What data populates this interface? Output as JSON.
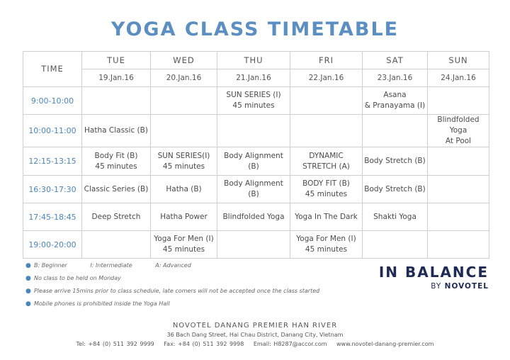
{
  "title": "YOGA CLASS TIMETABLE",
  "table": {
    "time_header": "TIME",
    "days": [
      "TUE",
      "WED",
      "THU",
      "FRI",
      "SAT",
      "SUN"
    ],
    "dates": [
      "19.Jan.16",
      "20.Jan.16",
      "21.Jan.16",
      "22.Jan.16",
      "23.Jan.16",
      "24.Jan.16"
    ],
    "rows": [
      {
        "time": "9:00-10:00",
        "cells": [
          [],
          [],
          [
            "SUN SERIES (I)",
            "45 minutes"
          ],
          [],
          [
            "Asana",
            "& Pranayama (I)"
          ],
          []
        ]
      },
      {
        "time": "10:00-11:00",
        "cells": [
          [
            "Hatha Classic (B)"
          ],
          [],
          [],
          [],
          [],
          [
            "Blindfolded Yoga",
            "At Pool"
          ]
        ]
      },
      {
        "time": "12:15-13:15",
        "cells": [
          [
            "Body Fit (B)",
            "45 minutes"
          ],
          [
            "SUN SERIES(I)",
            "45 minutes"
          ],
          [
            "Body Alignment (B)"
          ],
          [
            "DYNAMIC",
            "STRETCH (A)"
          ],
          [
            "Body Stretch (B)"
          ],
          []
        ]
      },
      {
        "time": "16:30-17:30",
        "cells": [
          [
            "Classic Series (B)"
          ],
          [
            "Hatha (B)"
          ],
          [
            "Body Alignment (B)"
          ],
          [
            "BODY FIT (B)",
            "45 minutes"
          ],
          [
            "Body Stretch (B)"
          ],
          []
        ]
      },
      {
        "time": "17:45-18:45",
        "cells": [
          [
            "Deep Stretch"
          ],
          [
            "Hatha Power"
          ],
          [
            "Blindfolded Yoga"
          ],
          [
            "Yoga In The Dark"
          ],
          [
            "Shakti Yoga"
          ],
          []
        ]
      },
      {
        "time": "19:00-20:00",
        "cells": [
          [],
          [
            "Yoga For Men (I)",
            "45 minutes"
          ],
          [],
          [
            "Yoga For Men (I)",
            "45 minutes"
          ],
          [],
          []
        ]
      }
    ]
  },
  "notes": {
    "legend": [
      "B: Beginner",
      "I: Intermediate",
      "A: Advanced"
    ],
    "items": [
      "No class to be held on Monday",
      "Please arrive 15mins prior to class schedule, late comers will not be accepted once the class started",
      "Mobile phones is prohibited inside the Yoga Hall"
    ]
  },
  "brand": {
    "name": "IN BALANCE",
    "by": "BY",
    "company": "NOVOTEL"
  },
  "footer": {
    "hotel": "NOVOTEL DANANG PREMIER HAN RIVER",
    "address": "36 Bach Dang Street, Hai Chau District, Danang City, Vietnam",
    "tel": "Tel: +84 (0) 511 392 9999",
    "fax": "Fax: +84 (0) 511 392 9998",
    "email": "Email: H8287@accor.com",
    "web": "www.novotel-danang-premier.com"
  },
  "colors": {
    "accent": "#5b8fc2",
    "time_text": "#4a86bf",
    "brand": "#1f2a55",
    "grid": "#cfcfcf"
  }
}
